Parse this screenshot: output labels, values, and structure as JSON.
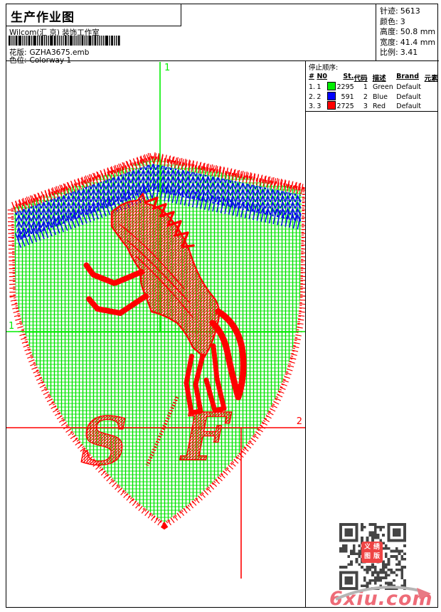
{
  "header": {
    "title": "生产作业图",
    "company": "Wilcom(汇 京) 装饰工作室",
    "pattern_label": "花版:",
    "pattern_value": "GZHA3675.emb",
    "colorway_label": "色位:",
    "colorway_value": "Colorway 1",
    "info": [
      {
        "label": "针迹:",
        "value": "5613"
      },
      {
        "label": "颜色:",
        "value": "3"
      },
      {
        "label": "高度:",
        "value": "50.8 mm"
      },
      {
        "label": "宽度:",
        "value": "41.4 mm"
      },
      {
        "label": "比例:",
        "value": "3.41"
      }
    ]
  },
  "stop_sequence": {
    "title": "停止顺序:",
    "columns": {
      "seq": "#",
      "needle": "N0",
      "stitches": "St.",
      "code": "代码",
      "description": "描述",
      "brand": "Brand",
      "element": "元素"
    },
    "rows": [
      {
        "seq": "1.",
        "needle": "1",
        "color": "#00EE00",
        "stitches": "2295",
        "code": "1",
        "description": "Green",
        "brand": "Default",
        "element": ""
      },
      {
        "seq": "2.",
        "needle": "2",
        "color": "#0000FF",
        "stitches": "591",
        "code": "2",
        "description": "Blue",
        "brand": "Default",
        "element": ""
      },
      {
        "seq": "3.",
        "needle": "3",
        "color": "#FF0000",
        "stitches": "2725",
        "code": "3",
        "description": "Red",
        "brand": "Default",
        "element": ""
      }
    ]
  },
  "design": {
    "start_marker": "1",
    "end_marker": "2",
    "colors": {
      "fill_green": "#00E400",
      "band_blue": "#0000F0",
      "stitch_red": "#FF0000"
    }
  },
  "watermark": {
    "site": "6xiu.com",
    "stamp_chars": [
      "义",
      "绣",
      "图",
      "版"
    ]
  }
}
